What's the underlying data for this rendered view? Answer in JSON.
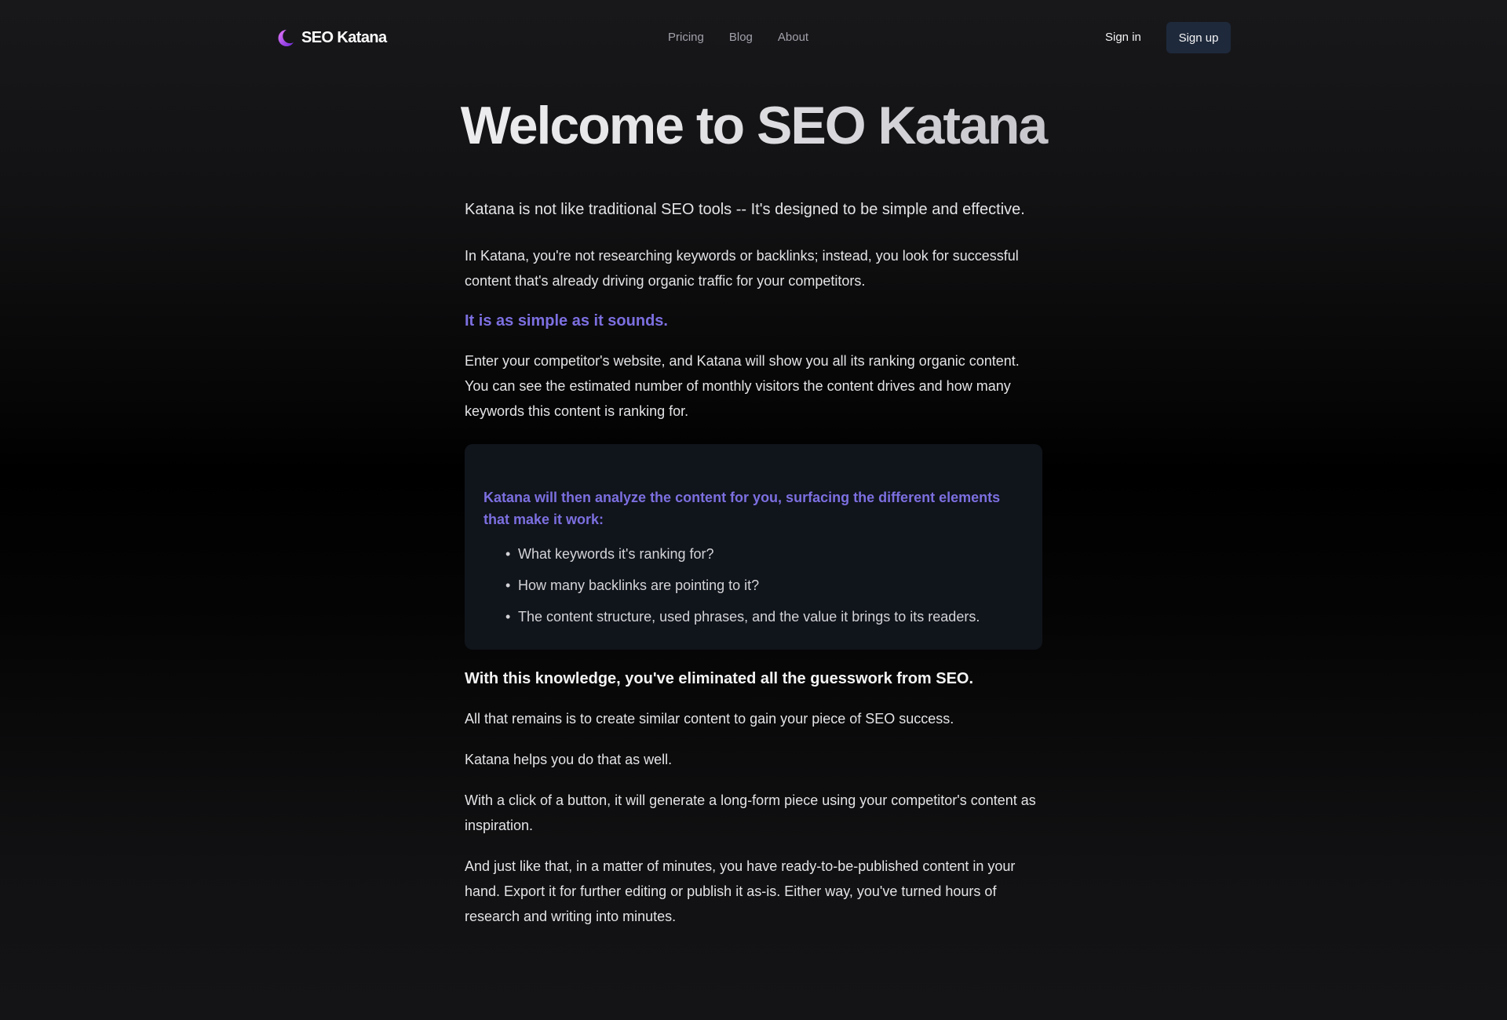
{
  "nav": {
    "brand": "SEO Katana",
    "links": [
      "Pricing",
      "Blog",
      "About"
    ],
    "signin": "Sign in",
    "signup": "Sign up"
  },
  "hero": {
    "title": "Welcome to SEO Katana"
  },
  "content": {
    "lead": "Katana is not like traditional SEO tools -- It's designed to be simple and effective.",
    "para1": "In Katana, you're not researching keywords or backlinks; instead, you look for successful content that's already driving organic traffic for your competitors.",
    "accent": "It is as simple as it sounds.",
    "para2": "Enter your competitor's website, and Katana will show you all its ranking organic content. You can see the estimated number of monthly visitors the content drives and how many keywords this content is ranking for.",
    "card": {
      "heading": "Katana will then analyze the content for you, surfacing the different elements that make it work:",
      "items": [
        "What keywords it's ranking for?",
        "How many backlinks are pointing to it?",
        "The content structure, used phrases, and the value it brings to its readers."
      ]
    },
    "strong": "With this knowledge, you've eliminated all the guesswork from SEO.",
    "para3": "All that remains is to create similar content to gain your piece of SEO success.",
    "para4": "Katana helps you do that as well.",
    "para5": "With a click of a button, it will generate a long-form piece using your competitor's content as inspiration.",
    "para6": "And just like that, in a matter of minutes, you have ready-to-be-published content in your hand. Export it for further editing or publish it as-is. Either way, you've turned hours of research and writing into minutes."
  },
  "colors": {
    "accent": "#7c6fe0",
    "card_bg": "#10141b",
    "signup_bg": "#1e293b",
    "logo_gradient_start": "#e879f9",
    "logo_gradient_end": "#6d28d9"
  },
  "icons": {
    "logo": "crescent-moon-icon"
  }
}
